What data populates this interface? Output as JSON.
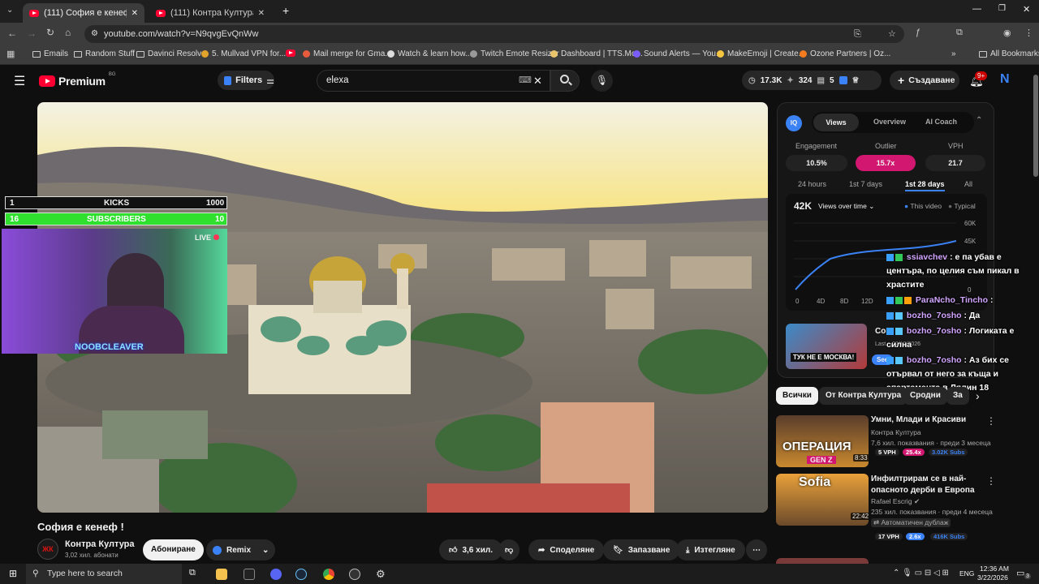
{
  "tabs": [
    {
      "label": "(111) София е кенеф ! - YouTube",
      "active": true
    },
    {
      "label": "(111) Контра Култура - YouTube",
      "active": false
    }
  ],
  "address": {
    "url": "youtube.com/watch?v=N9qvgEvQnWw"
  },
  "bookmarks": [
    "Emails",
    "Random Stuff",
    "Davinci Resolve",
    "5. Mullvad VPN for...",
    "Mail merge for Gma...",
    "Watch & learn how...",
    "Twitch Emote Resizer",
    "Dashboard | TTS.Mo...",
    "Sound Alerts — You...",
    "MakeEmoji | Create...",
    "Ozone Partners | Oz..."
  ],
  "all_bookmarks": "All Bookmarks",
  "header": {
    "logo": "Premium",
    "region": "BG",
    "filters": "Filters",
    "search_value": "elexa",
    "stats": {
      "views": "17.3K",
      "likes": "324",
      "comments": "5"
    },
    "create": "Създаване",
    "notif": "9+",
    "avatar": "N"
  },
  "overlay": {
    "kicks_num": "1",
    "kicks_label": "KICKS",
    "kicks_goal": "1000",
    "subs_num": "16",
    "subs_label": "SUBSCRIBERS",
    "subs_goal": "10",
    "live": "LIVE",
    "streamer": "NOOBCLEAVER"
  },
  "video": {
    "title": "София е кенеф !",
    "channel": "Контра Култура",
    "subs": "3,02 хил. абонати",
    "subscribe": "Абониране",
    "remix": "Remix",
    "likes": "3,6 хил.",
    "share": "Споделяне",
    "save": "Запазване",
    "download": "Изтегляне"
  },
  "vidiq": {
    "tabs": [
      "Views",
      "Overview",
      "AI Coach"
    ],
    "metrics": [
      {
        "label": "Engagement",
        "value": "10.5%"
      },
      {
        "label": "Outlier",
        "value": "15.7x"
      },
      {
        "label": "VPH",
        "value": "21.7"
      }
    ],
    "ranges": [
      "24 hours",
      "1st 7 days",
      "1st 28 days",
      "All"
    ],
    "total": "42K",
    "chart_select": "Views over time",
    "legend_this": "This video",
    "legend_typical": "Typical",
    "y_ticks": [
      "60K",
      "45K",
      "0"
    ],
    "x_ticks": [
      "0",
      "4D",
      "8D",
      "12D"
    ],
    "promo_title": "Co",
    "promo_date": "Last ...02/12/2026",
    "promo_btn": "See",
    "thumb_text": "ТУК НЕ Е МОСКВА!"
  },
  "chat": [
    {
      "user": "ssiavchev",
      "msg": ": е па убав е центъра, по целия съм пикал в храстите"
    },
    {
      "user": "ParaNcho_Tincho",
      "msg": ":"
    },
    {
      "user": "bozho_7osho",
      "msg": ": Да"
    },
    {
      "user": "bozho_7osho",
      "msg": ": Логиката е силна"
    },
    {
      "user": "bozho_7osho",
      "msg": ": Аз бих се отървал от него за къща и апартамента в Лялин 18"
    }
  ],
  "chips": [
    "Всички",
    "От Контра Култура",
    "Сродни",
    "За"
  ],
  "recs": [
    {
      "title": "Умни, Млади и Красиви",
      "channel": "Контра Култура",
      "meta": "7,6 хил. показвания · преди 3 месеца",
      "vph": "5 VPH",
      "outlier": "25.4x",
      "subs": "3.02K Subs",
      "duration": "8:33",
      "thumb_text": "ОПЕРАЦИЯ",
      "thumb_sub": "GEN Z"
    },
    {
      "title": "Инфилтрирам се в най-опасното дерби в Европа",
      "channel": "Rafael Escrig",
      "meta": "235 хил. показвания · преди 4 месеца",
      "dub": "Автоматичен дублаж",
      "vph": "17 VPH",
      "outlier": "2.6x",
      "subs": "416K Subs",
      "duration": "22:42",
      "thumb_text": "Sofia"
    }
  ],
  "taskbar": {
    "search": "Type here to search",
    "lang": "ENG",
    "time": "12:36 AM",
    "date": "3/22/2026",
    "notif": "3"
  },
  "colors": {
    "youtube_red": "#ff0033",
    "vidiq_pink": "#d1176f",
    "vidiq_blue": "#3b82f6",
    "goal_green": "#2fe02f"
  }
}
